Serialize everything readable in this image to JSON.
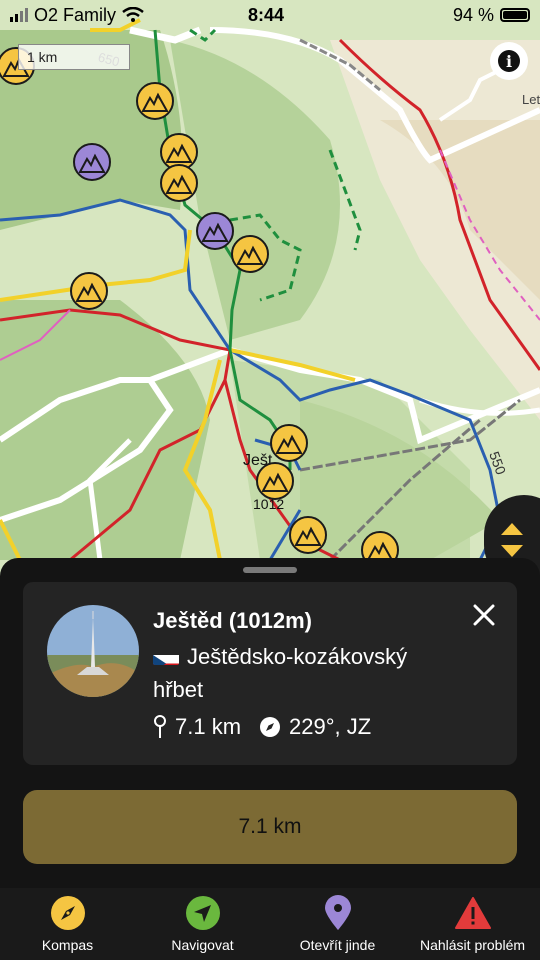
{
  "status_bar": {
    "carrier": "O2 Family",
    "time": "8:44",
    "battery_text": "94 %",
    "battery_level": 0.94
  },
  "map": {
    "scale_label": "1 km",
    "contour_labels": [
      "650",
      "550"
    ],
    "place_labels": {
      "town_partial": "Let",
      "peak_name_partial": "Ješt",
      "peak_elevation": "1012"
    },
    "colors": {
      "yellow_peak": "#f5c542",
      "purple_peak": "#9c87d6"
    }
  },
  "detail_card": {
    "title": "Ještěd (1012m)",
    "region": "Ještědsko-kozákovský hřbet",
    "distance": "7.1 km",
    "bearing": "229°, JZ",
    "primary_button_label": "7.1 km",
    "accent_color": "#7c6a34"
  },
  "tab_bar": {
    "items": [
      {
        "label": "Kompas",
        "icon": "compass-icon",
        "color": "#f5c542"
      },
      {
        "label": "Navigovat",
        "icon": "navigate-icon",
        "color": "#6ab83e"
      },
      {
        "label": "Otevřít jinde",
        "icon": "location-pin-icon",
        "color": "#9c87d6"
      },
      {
        "label": "Nahlásit problém",
        "icon": "warning-icon",
        "color": "#e23b3b"
      }
    ]
  }
}
